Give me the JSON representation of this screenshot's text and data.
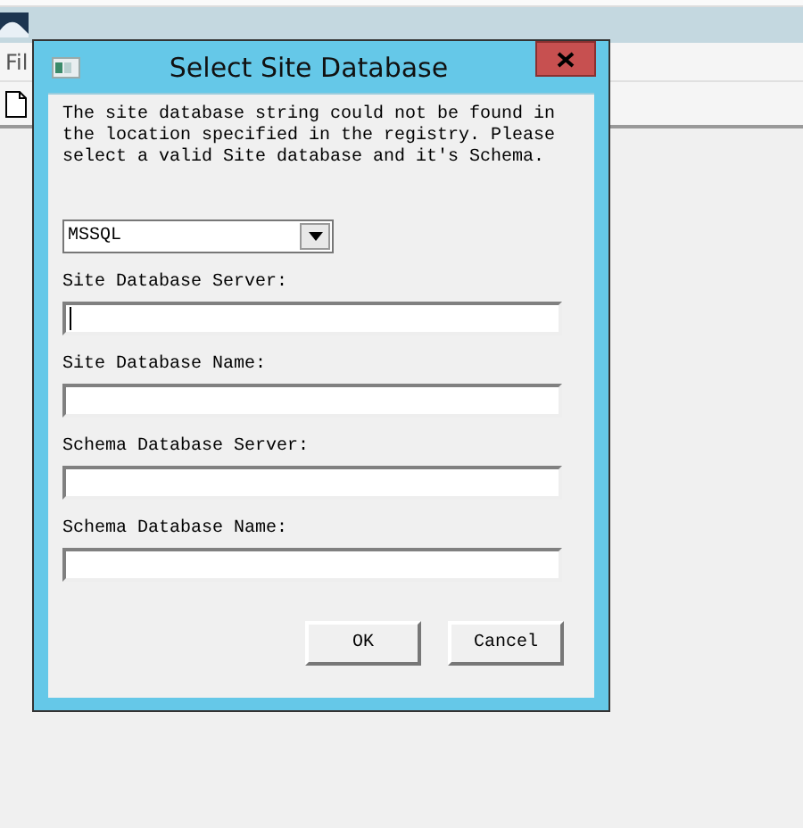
{
  "app": {
    "menu": [
      "Fil"
    ]
  },
  "dialog": {
    "title": "Select Site Database",
    "message": "The site database string could not be found in the location specified in the registry. Please select a valid Site database and it's Schema.",
    "database_type": "MSSQL",
    "fields": [
      {
        "label": "Site Database Server:",
        "focused": true
      },
      {
        "label": "Site Database Name:",
        "focused": false
      },
      {
        "label": "Schema Database Server:",
        "focused": false
      },
      {
        "label": "Schema Database Name:",
        "focused": false
      }
    ],
    "buttons": [
      "OK",
      "Cancel"
    ]
  }
}
